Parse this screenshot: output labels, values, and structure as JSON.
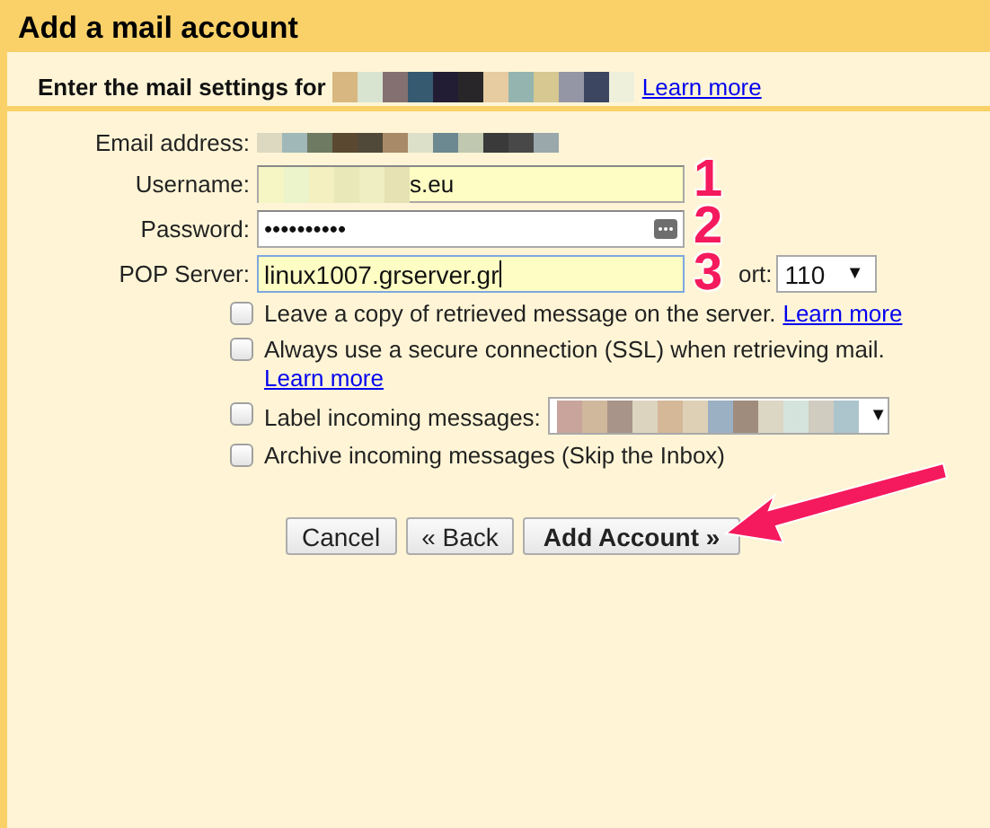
{
  "window": {
    "title": "Add a mail account"
  },
  "intro": {
    "text": "Enter the mail settings for",
    "link": "Learn more"
  },
  "fields": [
    {
      "kind": "static",
      "label": "Email address:"
    },
    {
      "kind": "text",
      "label": "Username:",
      "value": "s.eu",
      "focused": false
    },
    {
      "kind": "password",
      "label": "Password:",
      "value": "••••••••••",
      "focused": false
    },
    {
      "kind": "text",
      "label": "POP Server:",
      "value": "linux1007.grserver.gr",
      "focused": true
    }
  ],
  "port": {
    "label": "ort:",
    "value": "110",
    "arrow": "▼"
  },
  "options": [
    {
      "kind": "link",
      "text": "Leave a copy of retrieved message on the server.",
      "link": "Learn more",
      "checked": false
    },
    {
      "kind": "link-below",
      "text": "Always use a secure connection (SSL) when retrieving mail.",
      "link": "Learn more",
      "checked": false
    },
    {
      "kind": "select",
      "text": "Label incoming messages:",
      "arrow": "▼",
      "checked": false
    },
    {
      "kind": "plain",
      "text": "Archive incoming messages (Skip the Inbox)",
      "checked": false
    }
  ],
  "buttons": [
    {
      "label": "Cancel",
      "primary": false
    },
    {
      "label": "« Back",
      "primary": false
    },
    {
      "label": "Add Account »",
      "primary": true
    }
  ],
  "annotations": [
    "1",
    "2",
    "3"
  ]
}
